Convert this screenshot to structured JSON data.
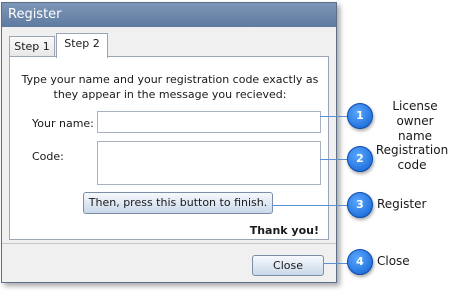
{
  "window": {
    "title": "Register"
  },
  "tabs": [
    {
      "label": "Step 1"
    },
    {
      "label": "Step 2"
    }
  ],
  "instruction_line1": "Type your name and your registration code exactly as",
  "instruction_line2": "they appear in the message you recieved:",
  "name_label": "Your name:",
  "name_value": "",
  "code_label": "Code:",
  "code_value": "",
  "finish_button": "Then, press this button to finish.",
  "thanks_text": "Thank you!",
  "close_button": "Close",
  "callouts": [
    {
      "number": "1",
      "line1": "License owner",
      "line2": "name"
    },
    {
      "number": "2",
      "line1": "Registration",
      "line2": "code"
    },
    {
      "number": "3",
      "line1": "Register",
      "line2": ""
    },
    {
      "number": "4",
      "line1": "Close",
      "line2": ""
    }
  ],
  "colors": {
    "title_bar": "#6a86ab",
    "callout_blue": "#1a72e8"
  }
}
